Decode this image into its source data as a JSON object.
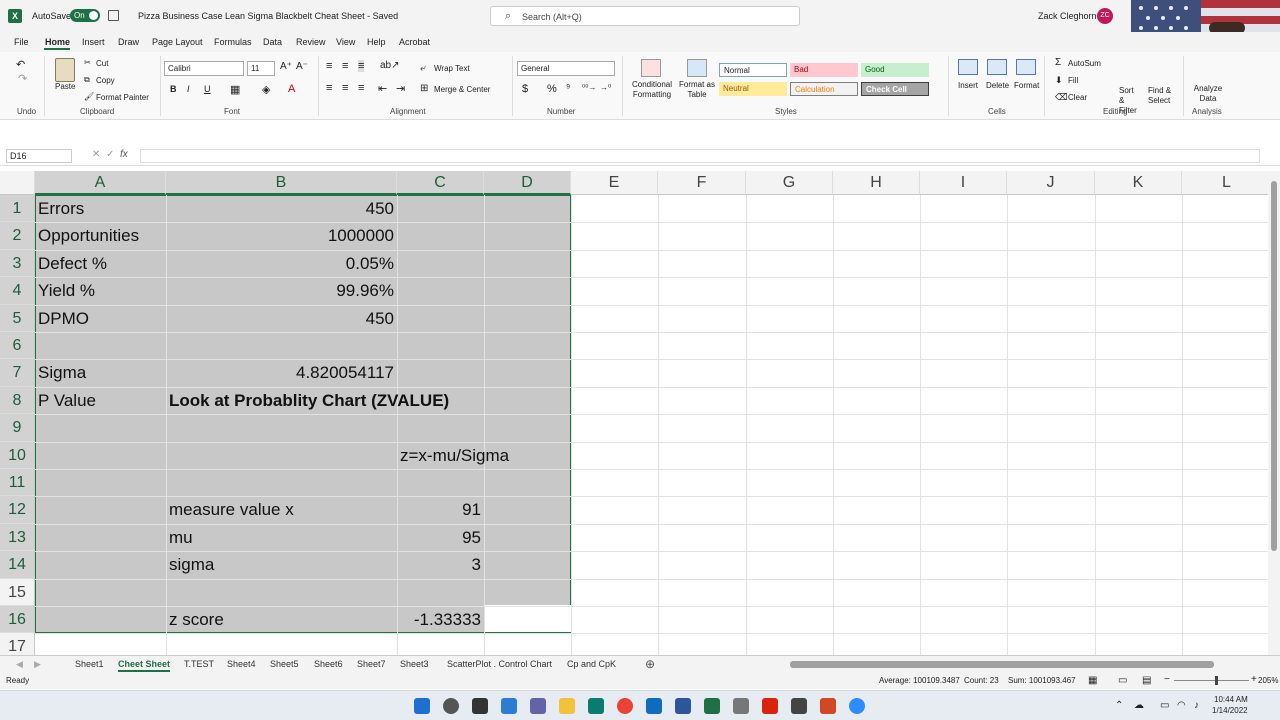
{
  "app": {
    "autosave_label": "AutoSave",
    "autosave_state": "On",
    "doc_title": "Pizza Business Case Lean Sigma Blackbelt Cheat Sheet  -  Saved",
    "search_placeholder": "Search (Alt+Q)",
    "user_name": "Zack Cleghorn",
    "user_initials": "ZC"
  },
  "menu": [
    "File",
    "Home",
    "Insert",
    "Draw",
    "Page Layout",
    "Formulas",
    "Data",
    "Review",
    "View",
    "Help",
    "Acrobat"
  ],
  "ribbon": {
    "undo_group": "Undo",
    "clipboard_group": "Clipboard",
    "paste": "Paste",
    "cut": "Cut",
    "copy": "Copy",
    "format_painter": "Format Painter",
    "font_group": "Font",
    "font_name": "Calibri",
    "font_size": "11",
    "bold": "B",
    "italic": "I",
    "underline": "U",
    "alignment_group": "Alignment",
    "wrap_text": "Wrap Text",
    "merge_center": "Merge & Center",
    "number_group": "Number",
    "number_format": "General",
    "styles_group": "Styles",
    "conditional_formatting": "Conditional Formatting",
    "format_as_table": "Format as Table",
    "style_normal": "Normal",
    "style_bad": "Bad",
    "style_good": "Good",
    "style_neutral": "Neutral",
    "style_calculation": "Calculation",
    "style_check_cell": "Check Cell",
    "cells_group": "Cells",
    "insert": "Insert",
    "delete": "Delete",
    "format": "Format",
    "editing_group": "Editing",
    "autosum": "AutoSum",
    "fill": "Fill",
    "clear": "Clear",
    "sort_filter": "Sort & Filter",
    "find_select": "Find & Select",
    "analysis_group": "Analysis",
    "analyze_data": "Analyze Data"
  },
  "formula_bar": {
    "name_box": "D16",
    "fx": "fx",
    "formula": ""
  },
  "grid": {
    "columns": [
      "A",
      "B",
      "C",
      "D",
      "E",
      "F",
      "G",
      "H",
      "I",
      "J",
      "K",
      "L"
    ],
    "rows": [
      "1",
      "2",
      "3",
      "4",
      "5",
      "6",
      "7",
      "8",
      "9",
      "10",
      "11",
      "12",
      "13",
      "14",
      "15",
      "16",
      "17"
    ],
    "cells": {
      "A1": "Errors",
      "B1": "450",
      "A2": "Opportunities",
      "B2": "1000000",
      "A3": "Defect %",
      "B3": "0.05%",
      "A4": "Yield %",
      "B4": "99.96%",
      "A5": "DPMO",
      "B5": "450",
      "A7": "Sigma",
      "B7": "4.820054117",
      "A8": "P Value",
      "B8": "Look at Probablity Chart (ZVALUE)",
      "C10": "z=x-mu/Sigma",
      "B12": "measure value x",
      "C12": "91",
      "B13": "mu",
      "C13": "95",
      "B14": "sigma",
      "C14": "3",
      "B16": "z score",
      "C16": "-1.33333"
    }
  },
  "sheets": [
    "Sheet1",
    "Cheet Sheet",
    "T.TEST",
    "Sheet4",
    "Sheet5",
    "Sheet6",
    "Sheet7",
    "Sheet3",
    "ScatterPlot . Control Chart",
    "Cp and CpK"
  ],
  "active_sheet": "Cheet Sheet",
  "status": {
    "ready": "Ready",
    "average": "Average: 100109.3487",
    "count": "Count: 23",
    "sum": "Sum: 1001093.467",
    "zoom": "205%"
  },
  "taskbar": {
    "time": "10:44 AM",
    "date": "1/14/2022"
  },
  "colors": {
    "excel_green": "#1e7145",
    "selection_gray": "#c8c8c8"
  }
}
